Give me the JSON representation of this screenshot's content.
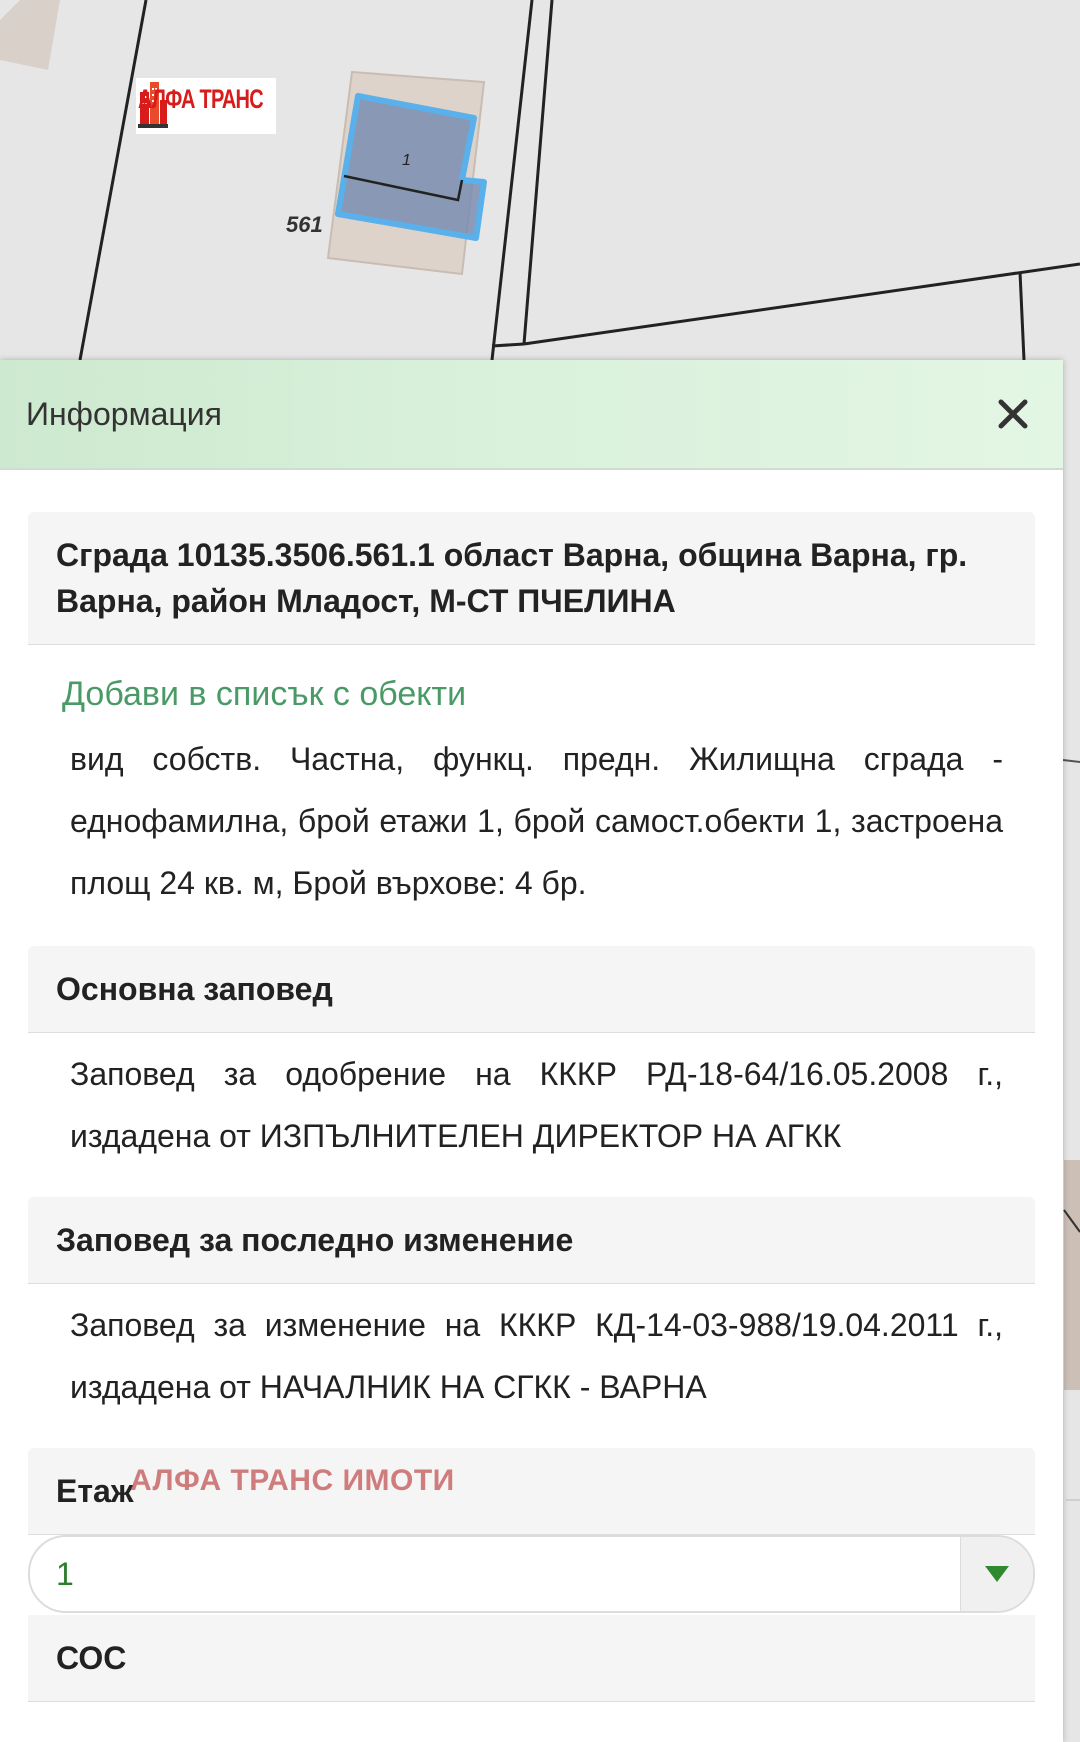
{
  "map": {
    "logo_text": "АЛФА ТРАНС",
    "parcel_number": "561",
    "building_number": "1"
  },
  "panel": {
    "title": "Информация",
    "building_heading": "Сграда 10135.3506.561.1 област Варна, община Варна, гр. Варна, район Младост, М-СТ ПЧЕЛИНА",
    "add_to_list": "Добави в списък с обекти",
    "description": "вид собств. Частна, функц. предн. Жилищна сграда - еднофамилна, брой етажи 1, брой самост.обекти 1, застроена площ 24 кв. м, Брой върхове: 4 бр.",
    "main_order_heading": "Основна заповед",
    "main_order_text": "Заповед за одобрение на КККР РД-18-64/16.05.2008 г., издадена от ИЗПЪЛНИТЕЛЕН ДИРЕКТОР НА АГКК",
    "last_change_heading": "Заповед за последно изменение",
    "last_change_text": "Заповед за изменение на КККР КД-14-03-988/19.04.2011 г., издадена от НАЧАЛНИК НА СГКК - ВАРНА",
    "floor_heading": "Етаж",
    "floor_value": "1",
    "sos_heading": "СОС"
  },
  "watermark": "АЛФА ТРАНС ИМОТИ",
  "colors": {
    "header_green": "#d8f0da",
    "link_green": "#4a9a67",
    "selected_value": "#2d7d2d",
    "building_fill": "#7a8db0",
    "building_stroke": "#5ab0ea",
    "logo_red": "#d81b1b"
  }
}
